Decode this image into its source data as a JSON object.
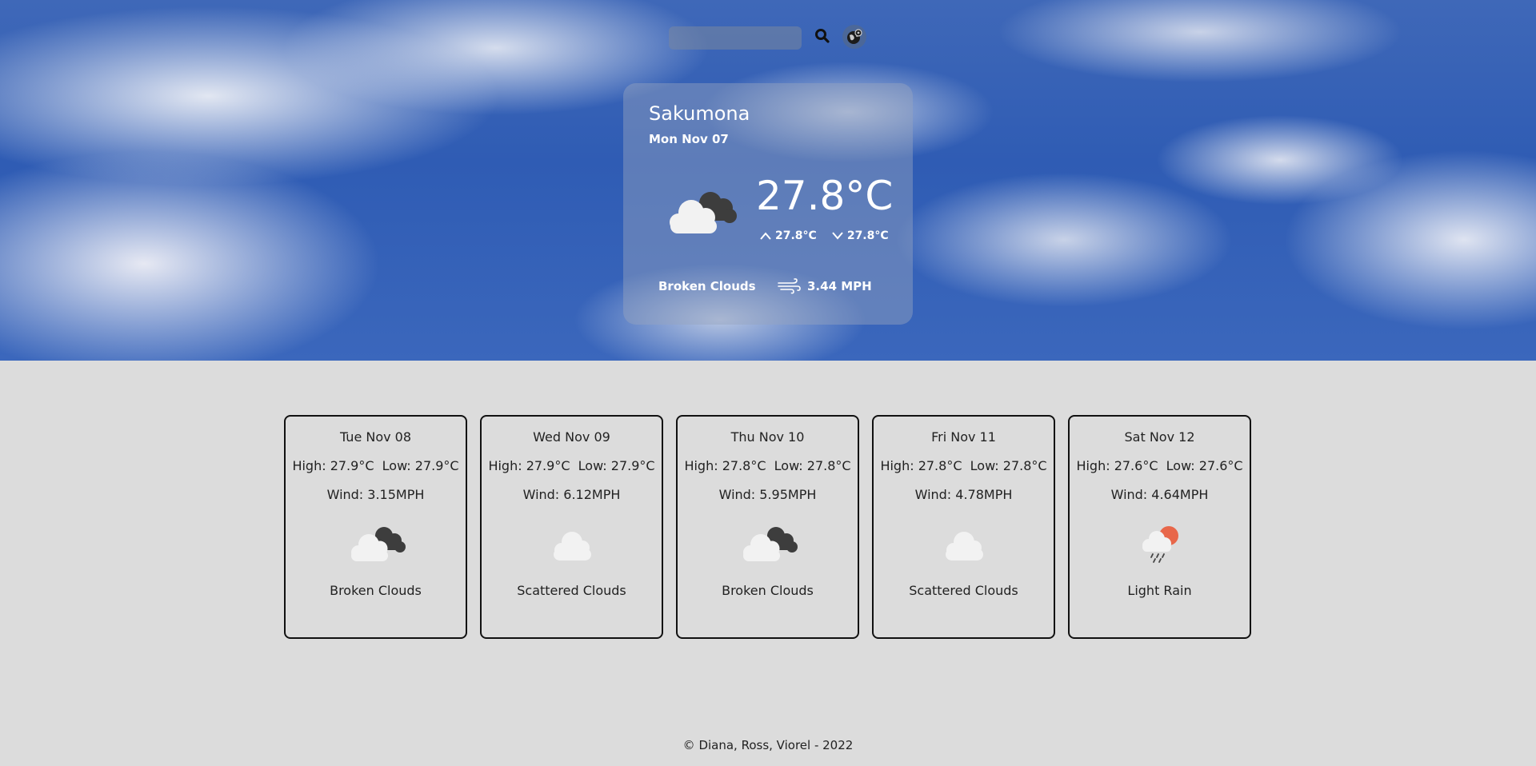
{
  "search": {
    "placeholder": "",
    "value": ""
  },
  "current": {
    "city": "Sakumona",
    "date": "Mon Nov 07",
    "temp": "27.8°C",
    "high": "27.8°C",
    "low": "27.8°C",
    "description": "Broken Clouds",
    "wind": "3.44 MPH",
    "icon": "broken-clouds-icon"
  },
  "forecast": [
    {
      "date": "Tue Nov 08",
      "highlow": "High: 27.9°C  Low: 27.9°C",
      "wind": "Wind: 3.15MPH",
      "description": "Broken Clouds",
      "icon": "broken-clouds-icon"
    },
    {
      "date": "Wed Nov 09",
      "highlow": "High: 27.9°C  Low: 27.9°C",
      "wind": "Wind: 6.12MPH",
      "description": "Scattered Clouds",
      "icon": "scattered-clouds-icon"
    },
    {
      "date": "Thu Nov 10",
      "highlow": "High: 27.8°C  Low: 27.8°C",
      "wind": "Wind: 5.95MPH",
      "description": "Broken Clouds",
      "icon": "broken-clouds-icon"
    },
    {
      "date": "Fri Nov 11",
      "highlow": "High: 27.8°C  Low: 27.8°C",
      "wind": "Wind: 4.78MPH",
      "description": "Scattered Clouds",
      "icon": "scattered-clouds-icon"
    },
    {
      "date": "Sat Nov 12",
      "highlow": "High: 27.6°C  Low: 27.6°C",
      "wind": "Wind: 4.64MPH",
      "description": "Light Rain",
      "icon": "light-rain-icon"
    }
  ],
  "footer": "© Diana, Ross, Viorel - 2022",
  "colors": {
    "page_bg": "#dcdcdc",
    "sky": "#2f5cb4",
    "sun": "#e8674a"
  }
}
